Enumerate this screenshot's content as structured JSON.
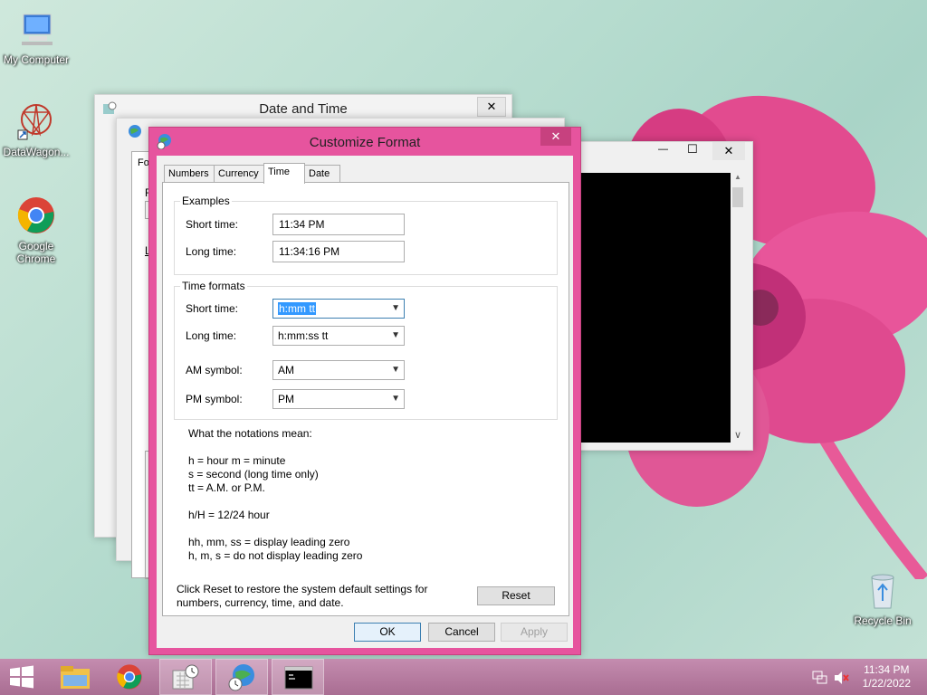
{
  "desktop": {
    "icons": [
      {
        "label": "My Computer"
      },
      {
        "label": "DataWagon..."
      },
      {
        "label": "Google Chrome"
      },
      {
        "label": "Recycle Bin"
      }
    ]
  },
  "date_time_window": {
    "title": "Date and Time",
    "close": "✕"
  },
  "back_dialog": {
    "tab_partial": "Fo",
    "letter_f": "F",
    "letter_l": "L"
  },
  "console_window": {
    "minimize": "—",
    "maximize": "☐",
    "close": "✕",
    "scroll_up": "▲",
    "scroll_down": "∨"
  },
  "dialog": {
    "title": "Customize Format",
    "close": "✕",
    "tabs": [
      {
        "label": "Numbers"
      },
      {
        "label": "Currency"
      },
      {
        "label": "Time"
      },
      {
        "label": "Date"
      }
    ],
    "examples": {
      "title": "Examples",
      "short_label": "Short time:",
      "short_value": "11:34 PM",
      "long_label": "Long time:",
      "long_value": "11:34:16 PM"
    },
    "formats": {
      "title": "Time formats",
      "short_label": "Short time:",
      "short_value": "h:mm tt",
      "long_label": "Long time:",
      "long_value": "h:mm:ss tt",
      "am_label": "AM symbol:",
      "am_value": "AM",
      "pm_label": "PM symbol:",
      "pm_value": "PM"
    },
    "notes": {
      "heading": "What the notations mean:",
      "line1": "h = hour   m = minute",
      "line2": "s = second (long time only)",
      "line3": "tt = A.M. or P.M.",
      "line4": "h/H = 12/24 hour",
      "line5": "hh, mm, ss = display leading zero",
      "line6": "h, m, s = do not display leading zero"
    },
    "reset_text_1": "Click Reset to restore the system default settings for",
    "reset_text_2": "numbers, currency, time, and date.",
    "reset_label": "Reset",
    "ok_label": "OK",
    "cancel_label": "Cancel",
    "apply_label": "Apply"
  },
  "taskbar": {
    "clock_time": "11:34 PM",
    "clock_date": "1/22/2022"
  },
  "colors": {
    "dialog_frame": "#e6549e",
    "taskbar": "#b97ea0",
    "selection": "#3399ff"
  }
}
